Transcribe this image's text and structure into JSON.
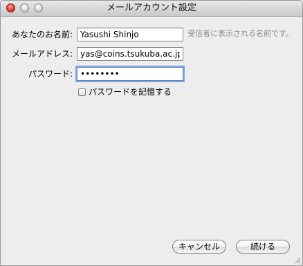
{
  "window": {
    "title": "メールアカウント設定"
  },
  "form": {
    "name_label": "あなたのお名前:",
    "name_value": "Yasushi Shinjo",
    "name_hint": "受信者に表示される名前です。",
    "email_label": "メールアドレス:",
    "email_value": "yas@coins.tsukuba.ac.jp",
    "password_label": "パスワード:",
    "password_value": "••••••••",
    "remember_password_label": "パスワードを記憶する",
    "remember_password_checked": false
  },
  "buttons": {
    "cancel_label": "キャンセル",
    "continue_label": "続ける"
  },
  "icons": {
    "close": "close-icon",
    "minimize": "minimize-icon",
    "zoom": "zoom-icon",
    "resize": "resize-grip-icon"
  },
  "colors": {
    "focus_ring": "#7fa8e3",
    "close_button": "#e64b3c",
    "hint_text": "#8a8a8a"
  }
}
